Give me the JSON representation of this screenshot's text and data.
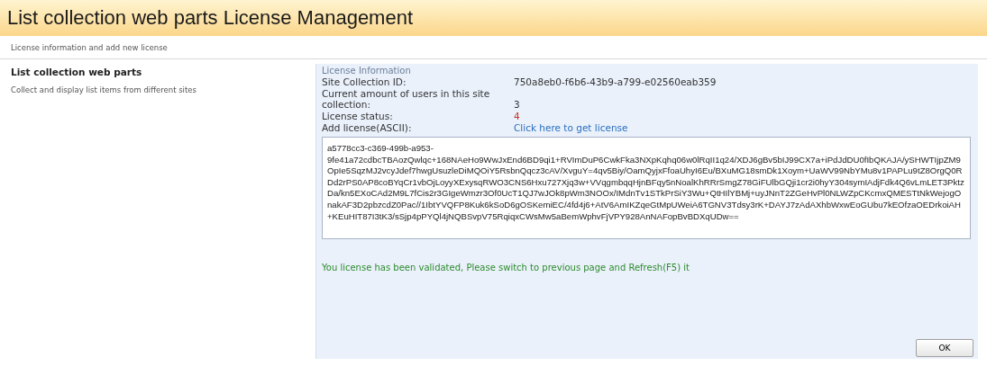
{
  "page_title": "List collection web parts License Management",
  "subtitle": "License information and add new license",
  "section": {
    "title": "List collection web parts",
    "description": "Collect and display list items from different sites"
  },
  "license_info": {
    "heading": "License Information",
    "rows": [
      {
        "label": "Site Collection ID:",
        "value": "750a8eb0-f6b6-43b9-a799-e02560eab359",
        "kind": "text"
      },
      {
        "label": "Current amount of users in this site collection:",
        "value": "3",
        "kind": "text"
      },
      {
        "label": "License status:",
        "value": "4",
        "kind": "warning"
      },
      {
        "label": "Add license(ASCII):",
        "value": "Click here to get license",
        "kind": "link"
      }
    ],
    "license_field": {
      "value": "a5778cc3-c369-499b-a953-9fe41a72cdbcTBAozQwlqc+168NAeHo9WwJxEnd6BD9qi1+RVImDuP6CwkFka3NXpKqhq06w0lRqII1q24/XDJ6gBv5bIJ99CX7a+iPdJdDU0fIbQKAJA/ySHWTIjpZM9OpIe5SqzMJ2vcyJdef7hwgUsuzleDiMQOiY5RsbnQqcz3cAV/XvguY=4qv5Biy/OamQyjxFfoaUhyI6Eu/BXuMG18smDk1Xoym+UaWV99NbYMu8v1PAPLu9tZ8OrgQ0RDd2rPS0AP8coBYqCr1vbOjLoyyXExysqRWO3CNS6Hxu727Xjq3w+VVqgmbqqHjnBFqy5nNoalKhRRrSmgZ78GiFUlbGQji1cr2i0hyY304symIAdjFdk4Q6vLmLET3PktzDa/kn5EXoCAd2M9L7fCis2r3GIgeWmzr3Of0UcT1QJ7wJOk8pWm3NOOx/IMdnTv1STkPrSiY3Wu+QtHIlYBMj+uyJNnT2ZGeHvPl0NLWZpCKcmxQMESTtNkWejogOnakAF3D2pbzcdZ0Pac//1IbtYVQFP8Kuk6kSoD6gOSKemiEC/4fd4j6+AtV6AmIKZqeGtMpUWeiA6TGNV3Tdsy3rK+DAYJ7zAdAXhbWxwEoGUbu7kEOfzaOEDrkoiAH+KEuHIT87I3tK3/sSjp4pPYQl4jNQBSvpV75RqiqxCWsMw5aBemWphvFjVPY928AnNAFopBvBDXqUDw=="
    },
    "message": "You license has been validated, Please switch to previous page and Refresh(F5) it"
  },
  "buttons": [
    "OK"
  ]
}
